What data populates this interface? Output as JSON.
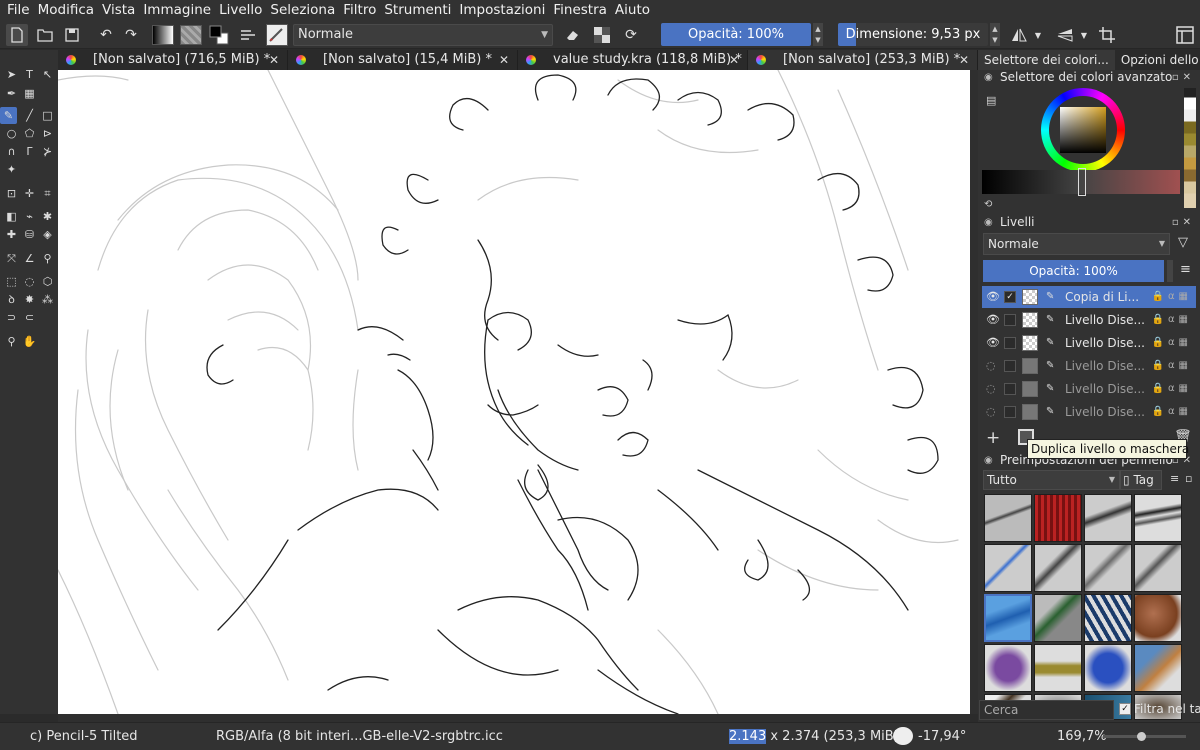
{
  "menu": [
    "File",
    "Modifica",
    "Vista",
    "Immagine",
    "Livello",
    "Seleziona",
    "Filtro",
    "Strumenti",
    "Impostazioni",
    "Finestra",
    "Aiuto"
  ],
  "toolbar": {
    "blend_mode": "Normale",
    "opacity_label": "Opacità: 100%",
    "opacity_fraction": 1.0,
    "size_label": "Dimensione: 9,53 px",
    "size_fraction": 0.12
  },
  "tabs": [
    {
      "title": "[Non salvato]  (716,5 MiB) *"
    },
    {
      "title": "[Non salvato]  (15,4 MiB) *"
    },
    {
      "title": "value study.kra (118,8 MiB) *"
    },
    {
      "title": "[Non salvato]  (253,3 MiB) *",
      "active": true
    }
  ],
  "dock": {
    "tabs": [
      "Selettore dei colori...",
      "Opzioni dello ..."
    ],
    "color_panel_title": "Selettore dei colori avanzato",
    "layers_panel_title": "Livelli",
    "layers_blend": "Normale",
    "layers_opacity": "Opacità: 100%",
    "layers": [
      {
        "name": "Copia di Li...",
        "visible": true,
        "selected": true,
        "checked": true
      },
      {
        "name": "Livello Dise...",
        "visible": true
      },
      {
        "name": "Livello Dise...",
        "visible": true
      },
      {
        "name": "Livello Dise...",
        "visible": false
      },
      {
        "name": "Livello Dise...",
        "visible": false
      },
      {
        "name": "Livello Dise...",
        "visible": false
      }
    ],
    "tooltip": "Duplica livello o maschera",
    "presets_title": "Preimpostazioni del pennello",
    "presets_filter": "Tutto",
    "presets_tag": "Tag",
    "search_placeholder": "Cerca",
    "filter_tag_label": "Filtra nel tag"
  },
  "status": {
    "brush": "c) Pencil-5 Tilted",
    "color_space": "RGB/Alfa (8 bit interi...GB-elle-V2-srgbtrc.icc",
    "dims_a": "2.143",
    "dims_rest": " x 2.374 (253,3 MiB)",
    "rotation": "-17,94°",
    "zoom": "169,7%"
  },
  "colors": {
    "accent": "#4a73c2",
    "panel": "#323232",
    "canvas": "#ffffff"
  }
}
